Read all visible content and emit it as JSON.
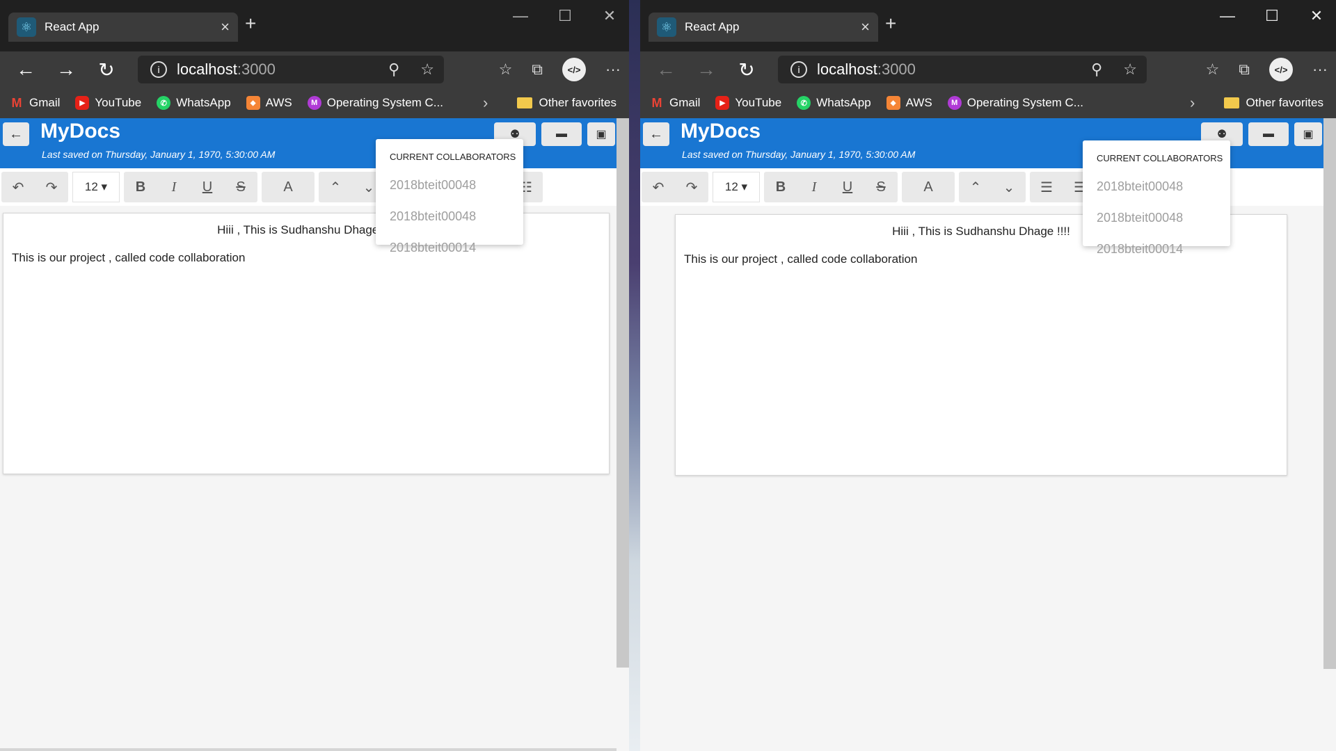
{
  "browser": {
    "tab_title": "React App",
    "tab_close": "×",
    "new_tab": "+",
    "url_host": "localhost",
    "url_port": ":3000",
    "bookmarks": [
      "Gmail",
      "YouTube",
      "WhatsApp",
      "AWS",
      "Operating System C..."
    ],
    "other_favorites": "Other favorites"
  },
  "app": {
    "title": "MyDocs",
    "last_saved": "Last saved on Thursday, January 1, 1970, 5:30:00 AM",
    "font_size": "12",
    "doc_line1": "Hiii , This is Sudhanshu Dhage !!!!",
    "doc_line2": "This is our project , called code collaboration"
  },
  "collaborators": {
    "title": "CURRENT COLLABORATORS",
    "users": [
      "2018bteit00048",
      "2018bteit00048",
      "2018bteit00014"
    ]
  },
  "icons": {
    "back": "←",
    "forward": "→",
    "refresh": "↻",
    "minimize": "—",
    "maximize": "☐",
    "close": "✕",
    "undo": "↶",
    "redo": "↷",
    "bold": "B",
    "italic": "I",
    "underline": "U",
    "strike": "S",
    "color": "A",
    "up": "⌃",
    "down": "⌄",
    "bullets": "☰",
    "numbered": "☷",
    "align": "☰",
    "people": "👥",
    "trash": "🗑",
    "save": "💾",
    "arrow_left": "←"
  },
  "colors": {
    "header": "#1976d2",
    "chrome_dark": "#202020",
    "chrome_mid": "#3b3b3b"
  }
}
